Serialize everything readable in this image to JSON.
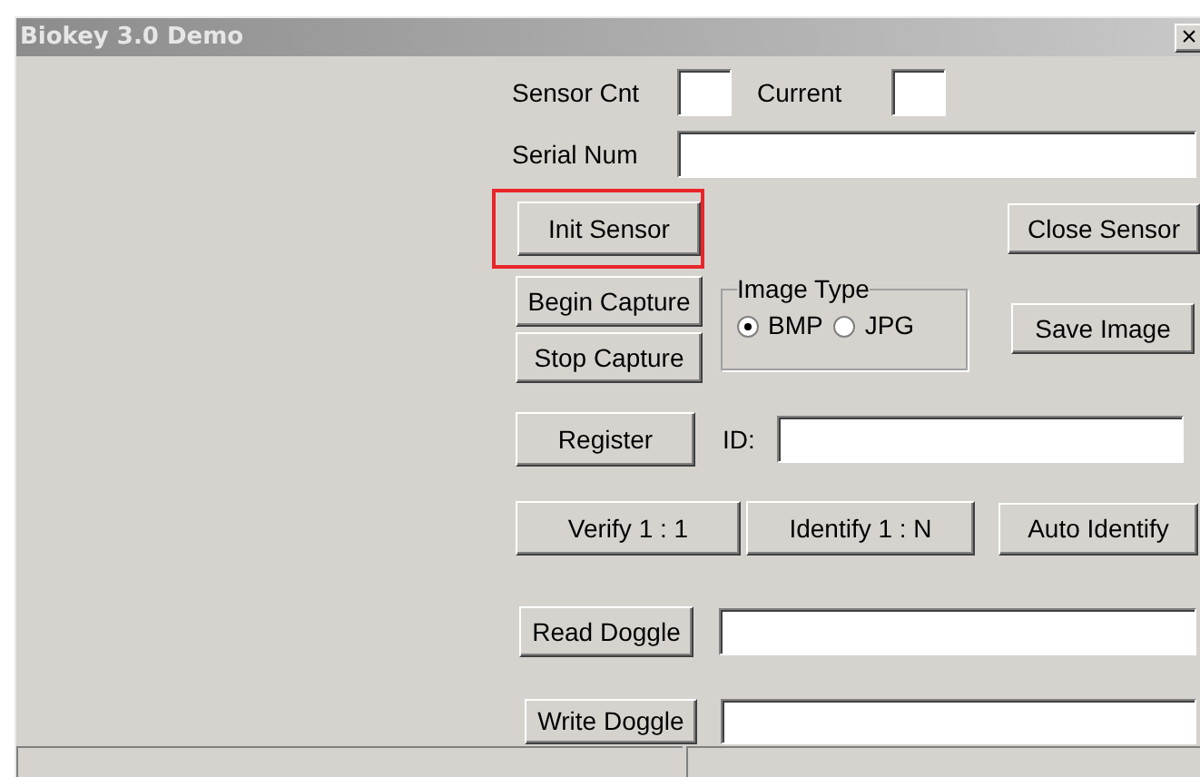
{
  "window": {
    "title": "Biokey 3.0 Demo",
    "close": "×"
  },
  "sensor": {
    "count_label": "Sensor Cnt",
    "current_label": "Current",
    "serial_label": "Serial Num"
  },
  "buttons": {
    "init": "Init Sensor",
    "close_sensor": "Close  Sensor",
    "begin_capture": "Begin Capture",
    "stop_capture": "Stop Capture",
    "save_image": "Save Image",
    "register": "Register",
    "verify": "Verify 1 : 1",
    "identify": "Identify 1 : N",
    "auto_identify": "Auto Identify",
    "read_doggle": "Read Doggle",
    "write_doggle": "Write Doggle"
  },
  "image_type": {
    "label": "Image Type",
    "options": [
      {
        "label": "BMP",
        "selected": true
      },
      {
        "label": "JPG",
        "selected": false
      }
    ]
  },
  "id_label": "ID:"
}
